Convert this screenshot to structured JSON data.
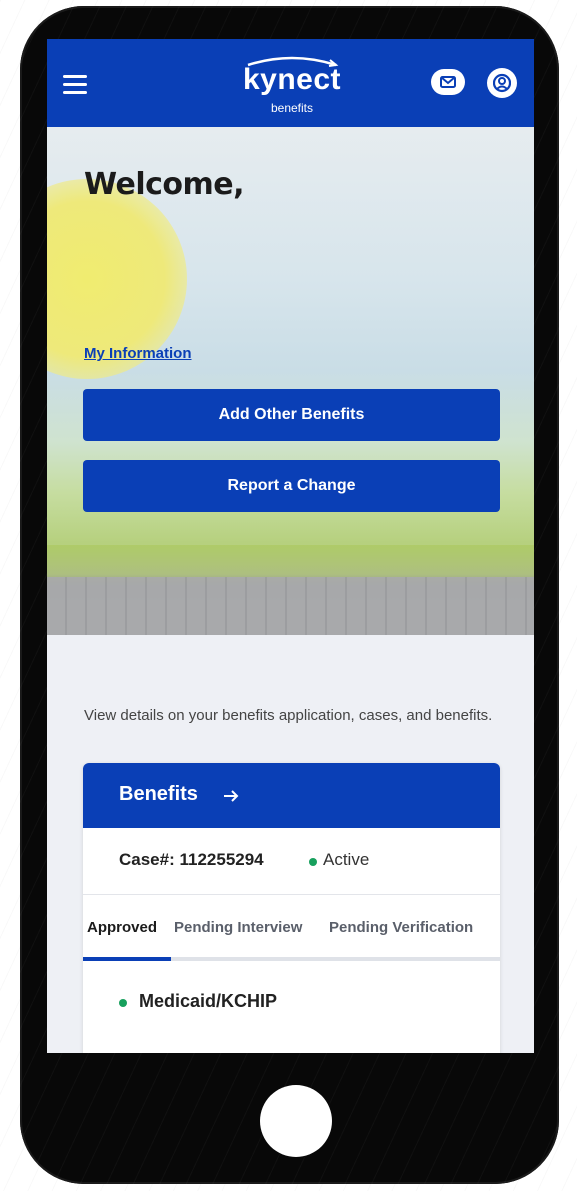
{
  "header": {
    "logo_word": "kynect",
    "logo_sub": "benefits"
  },
  "hero": {
    "welcome": "Welcome,",
    "my_information_link": "My Information",
    "add_benefits_button": "Add Other Benefits",
    "report_change_button": "Report a Change"
  },
  "summary": {
    "description": "View details on your benefits application, cases, and benefits."
  },
  "benefits_card": {
    "title": "Benefits",
    "case_label": "Case#: 112255294",
    "status": "Active",
    "tabs": [
      {
        "label": "Approved",
        "selected": true
      },
      {
        "label": "Pending Interview",
        "selected": false
      },
      {
        "label": "Pending Verification",
        "selected": false
      }
    ],
    "items": [
      {
        "label": "Medicaid/KCHIP",
        "status_color": "#17a05d"
      }
    ]
  },
  "icons": {
    "menu": "menu-icon",
    "mail": "mail-icon",
    "user": "user-icon",
    "arrow": "arrow-right-icon"
  },
  "colors": {
    "brand_blue": "#0a3fb6",
    "active_green": "#17a05d"
  }
}
